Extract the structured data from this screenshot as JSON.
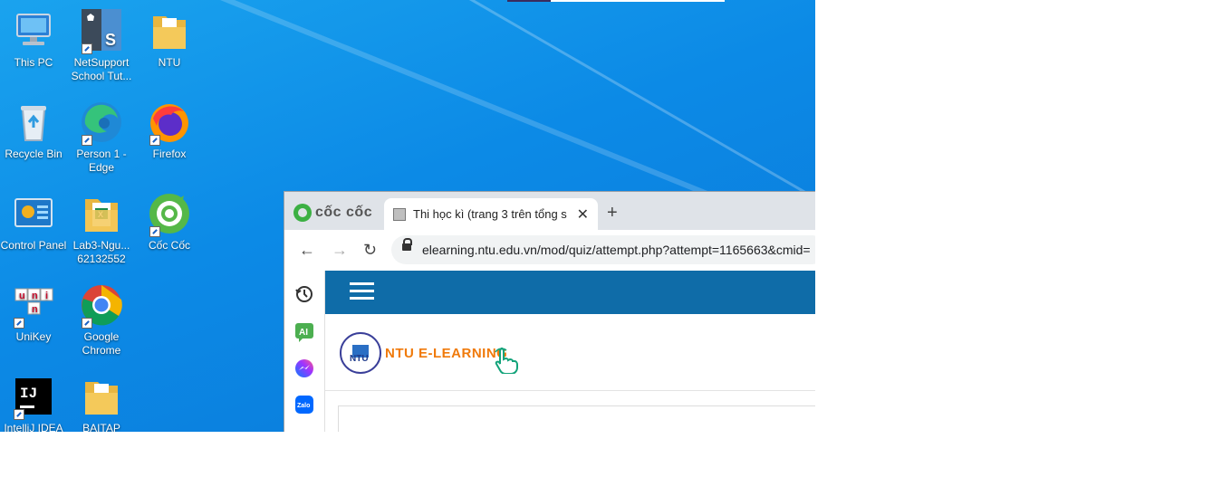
{
  "desktop": {
    "icons": [
      {
        "label": "This PC",
        "icon": "computer-icon"
      },
      {
        "label": "NetSupport School Tut...",
        "icon": "netsupport-icon"
      },
      {
        "label": "NTU",
        "icon": "folder-icon"
      },
      {
        "label": "Recycle Bin",
        "icon": "recycle-bin-icon"
      },
      {
        "label": "Person 1 - Edge",
        "icon": "edge-icon"
      },
      {
        "label": "Firefox",
        "icon": "firefox-icon"
      },
      {
        "label": "Control Panel",
        "icon": "control-panel-icon"
      },
      {
        "label": "Lab3-Ngu... 62132552",
        "icon": "excel-folder-icon"
      },
      {
        "label": "Cốc Cốc",
        "icon": "coccoc-icon"
      },
      {
        "label": "UniKey",
        "icon": "unikey-icon"
      },
      {
        "label": "Google Chrome",
        "icon": "chrome-icon"
      },
      {
        "label": "IntelliJ IDEA",
        "icon": "intellij-icon"
      },
      {
        "label": "BAITAP",
        "icon": "folder-icon"
      }
    ]
  },
  "browser": {
    "brand": "cốc cốc",
    "tab_title": "Thi học kì (trang 3 trên tổng s",
    "close_glyph": "✕",
    "newtab_glyph": "+",
    "back_glyph": "←",
    "forward_glyph": "→",
    "reload_glyph": "↻",
    "url": "elearning.ntu.edu.vn/mod/quiz/attempt.php?attempt=1165663&cmid=",
    "sidebar": [
      "history-icon",
      "ai-icon",
      "messenger-icon",
      "zalo-icon"
    ],
    "ai_label": "AI",
    "zalo_label": "Zalo"
  },
  "site": {
    "seal_text": "NTU",
    "brand_text": "NTU E-LEARNING"
  },
  "colors": {
    "desktop_blue": "#0c8ae6",
    "navbar": "#0f6ca8",
    "brand_orange": "#f07a0a"
  }
}
